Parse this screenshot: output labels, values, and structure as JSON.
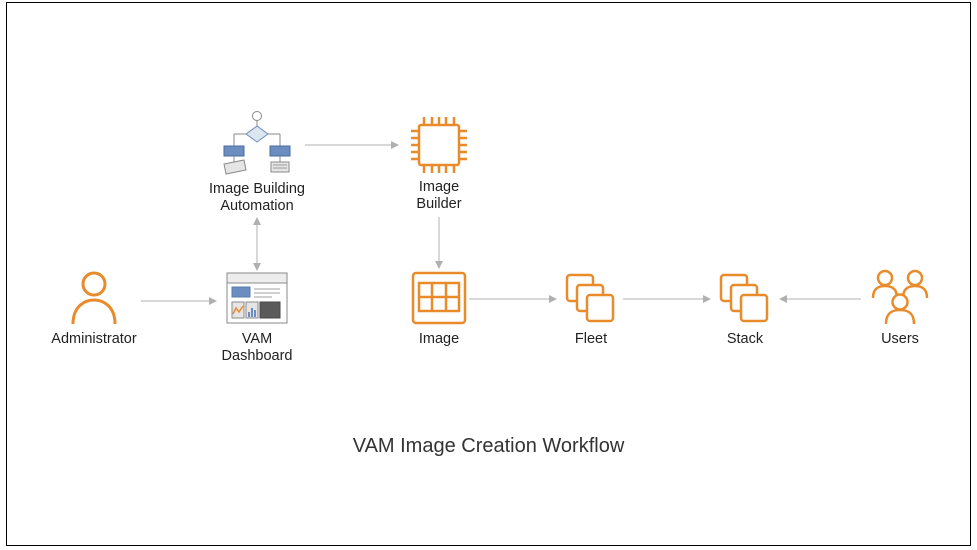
{
  "title": "VAM Image Creation Workflow",
  "nodes": {
    "administrator": {
      "label": "Administrator"
    },
    "vam_dashboard": {
      "label_line1": "VAM",
      "label_line2": "Dashboard"
    },
    "image_building_automation": {
      "label_line1": "Image Building",
      "label_line2": "Automation"
    },
    "image_builder": {
      "label_line1": "Image",
      "label_line2": "Builder"
    },
    "image": {
      "label": "Image"
    },
    "fleet": {
      "label": "Fleet"
    },
    "stack": {
      "label": "Stack"
    },
    "users": {
      "label": "Users"
    }
  },
  "colors": {
    "orange": "#E98B2A",
    "orange_light": "#F5A623",
    "grey_icon": "#8A8A8A",
    "blue_fill": "#6C8DBF",
    "grey_fill": "#E5E5E5"
  }
}
